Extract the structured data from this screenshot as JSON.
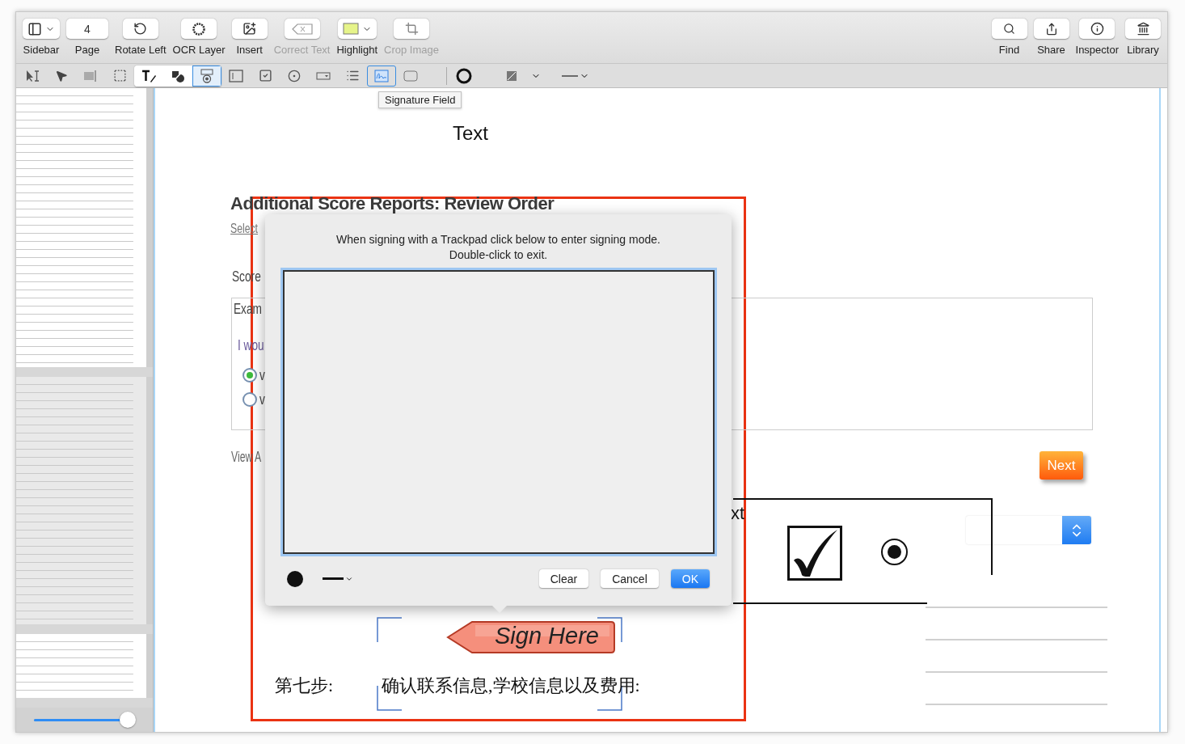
{
  "toolbar": {
    "left": [
      {
        "label": "Sidebar",
        "kind": "dropdown",
        "disabled": false
      },
      {
        "label": "Page",
        "kind": "field",
        "value": "4",
        "disabled": false
      },
      {
        "label": "Rotate Left",
        "kind": "button",
        "disabled": false
      },
      {
        "label": "OCR Layer",
        "kind": "button",
        "disabled": false
      },
      {
        "label": "Insert",
        "kind": "button",
        "disabled": false
      },
      {
        "label": "Correct Text",
        "kind": "button",
        "disabled": true
      },
      {
        "label": "Highlight",
        "kind": "dropdown",
        "disabled": false
      },
      {
        "label": "Crop Image",
        "kind": "button",
        "disabled": true
      }
    ],
    "right": [
      {
        "label": "Find",
        "kind": "button",
        "disabled": false
      },
      {
        "label": "Share",
        "kind": "button",
        "disabled": false
      },
      {
        "label": "Inspector",
        "kind": "button",
        "disabled": false
      },
      {
        "label": "Library",
        "kind": "button",
        "disabled": false
      }
    ]
  },
  "tools": [
    {
      "kind": "plain",
      "selected": false
    },
    {
      "kind": "plain",
      "selected": false
    },
    {
      "kind": "plain",
      "selected": false
    },
    {
      "kind": "plain",
      "selected": false
    },
    {
      "kind": "grouped",
      "selected": false
    },
    {
      "kind": "grouped",
      "selected": false
    },
    {
      "kind": "grouped",
      "selected": true
    },
    {
      "kind": "plain",
      "selected": false
    },
    {
      "kind": "plain",
      "selected": false
    },
    {
      "kind": "plain",
      "selected": false
    },
    {
      "kind": "plain",
      "selected": false
    },
    {
      "kind": "plain",
      "selected": false
    },
    {
      "kind": "plain",
      "selected": true
    },
    {
      "kind": "plain",
      "selected": false
    }
  ],
  "tooltip": "Signature Field",
  "sidebar": {
    "thumbnails": [
      {
        "selected": false
      },
      {
        "selected": true
      },
      {
        "selected": false
      }
    ],
    "zoom": {
      "level": 0.93
    }
  },
  "document": {
    "page_title": "Text",
    "heading": "Additional Score Reports: Review Order",
    "breadcrumb": "Select",
    "section": "Score",
    "box_title": "Exam",
    "prompt": "I wou",
    "options": [
      {
        "label": "v",
        "selected": true
      },
      {
        "label": "v",
        "selected": false
      }
    ],
    "link": "View A",
    "next_button": "Next",
    "form_box": {
      "label": "xt",
      "checked": true,
      "radio_selected": true
    },
    "sign_here": "Sign Here",
    "step_label": "第七步:",
    "step_text": "确认联系信息,学校信息以及费用:"
  },
  "signature_dialog": {
    "message": "When signing with a Trackpad click below to enter signing mode.\nDouble-click to exit.",
    "buttons": [
      {
        "label": "Clear",
        "kind": "normal"
      },
      {
        "label": "Cancel",
        "kind": "normal"
      },
      {
        "label": "OK",
        "kind": "default"
      }
    ]
  }
}
